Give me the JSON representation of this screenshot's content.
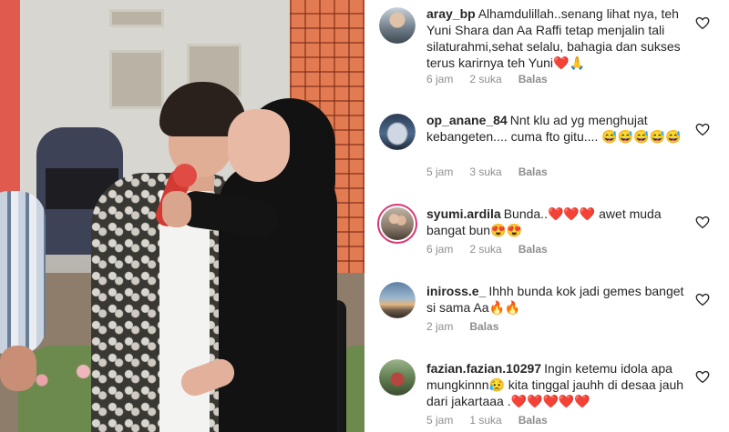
{
  "photo": {
    "alt": ""
  },
  "comments": [
    {
      "username": "aray_bp",
      "text": "Alhamdulillah..senang lihat nya, teh Yuni Shara dan Aa Raffi tetap menjalin tali silaturahmi,sehat selalu, bahagia dan sukses terus karirnya teh Yuni❤️🙏",
      "time": "6 jam",
      "likes": "2 suka",
      "reply": "Balas",
      "avatar_color": "#6d7a86",
      "story_ring": false
    },
    {
      "username": "op_anane_84",
      "text": "Nnt klu ad yg menghujat kebangeten.... cuma fto gitu.... 😅😅😅😅😅",
      "time": "5 jam",
      "likes": "3 suka",
      "reply": "Balas",
      "avatar_color": "#3f5a78",
      "story_ring": false
    },
    {
      "username": "syumi.ardila",
      "text": "Bunda..❤️❤️❤️ awet muda bangat bun😍😍",
      "time": "6 jam",
      "likes": "2 suka",
      "reply": "Balas",
      "avatar_color": "#8a7a6a",
      "story_ring": true
    },
    {
      "username": "iniross.e_",
      "text": "Ihhh bunda kok jadi gemes banget si sama Aa🔥🔥",
      "time": "2 jam",
      "likes": "",
      "reply": "Balas",
      "avatar_color": "#7c98b6",
      "story_ring": false
    },
    {
      "username": "fazian.fazian.10297",
      "text": "Ingin ketemu idola apa mungkinnn😥 kita tinggal jauhh di desaa jauh dari jakartaaa .❤️❤️❤️❤️❤️",
      "time": "5 jam",
      "likes": "1 suka",
      "reply": "Balas",
      "avatar_color": "#5e7a4e",
      "story_ring": false
    }
  ],
  "icons": {
    "like": "heart-outline-icon"
  },
  "colors": {
    "meta": "#8e8e8e",
    "text": "#262626",
    "story_ring": "#d93775"
  }
}
